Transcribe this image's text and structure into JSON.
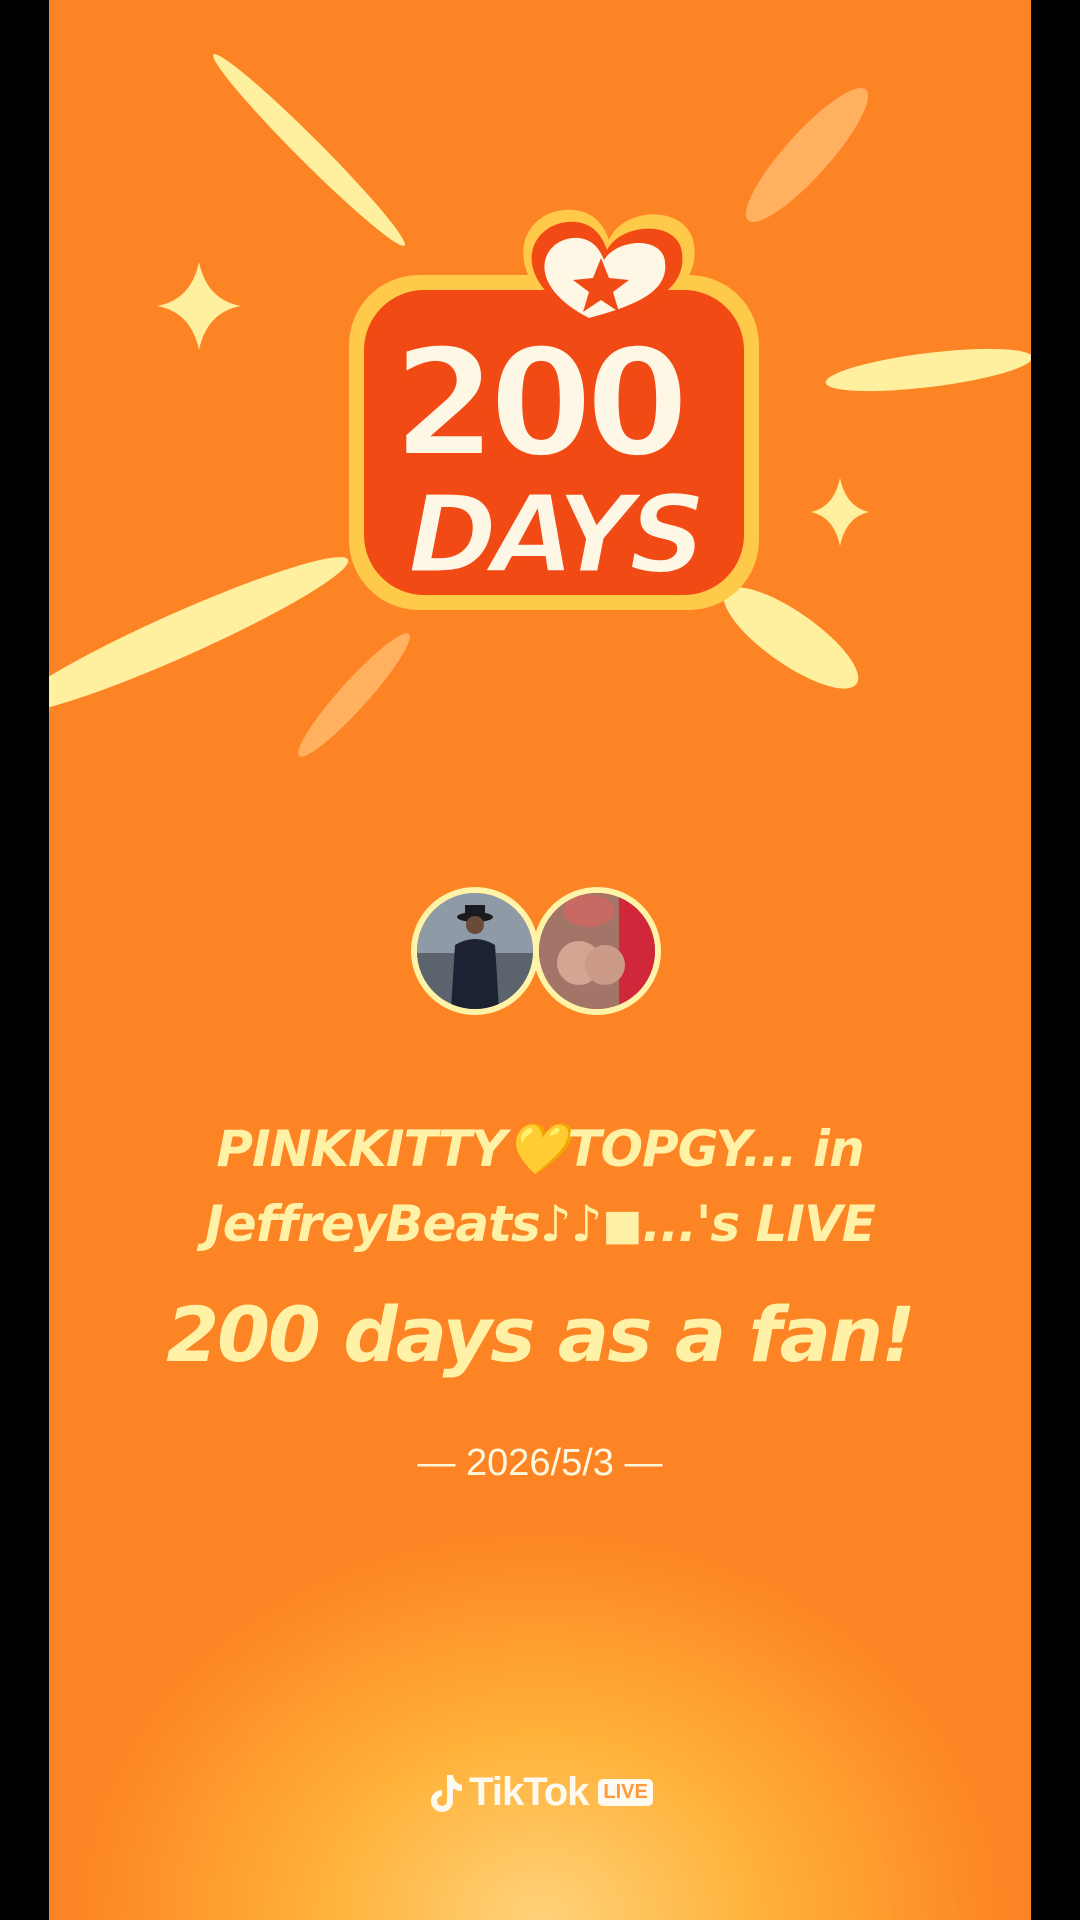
{
  "badge": {
    "number": "200",
    "word": "DAYS"
  },
  "avatars": [
    {
      "name": "avatar-topgy"
    },
    {
      "name": "avatar-pinkkitty"
    }
  ],
  "message": {
    "line1": "PINKKITTY💛TOPGY... in",
    "line2": "JeffreyBeats♪♪◼...'s LIVE",
    "headline": "200 days as a fan!"
  },
  "date": "— 2026/5/3 —",
  "brand": {
    "name": "TikTok",
    "tag": "LIVE"
  },
  "colors": {
    "background": "#fd8424",
    "text": "#fff1a6",
    "badge_red": "#f24a14",
    "badge_cream": "#fff7e6",
    "ray": "#fff0a0"
  }
}
